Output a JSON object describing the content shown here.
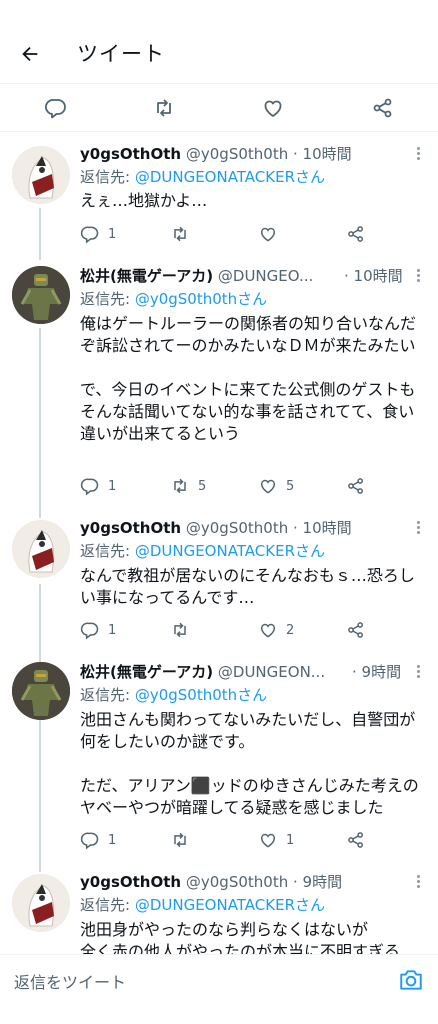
{
  "header": {
    "title": "ツイート"
  },
  "tweets": [
    {
      "name": "y0gsOthOth",
      "handle": "@y0gS0th0th",
      "time": "· 10時間",
      "reply_label": "返信先: ",
      "reply_to": "@DUNGEONATACKERさん",
      "text": "えぇ…地獄かよ…",
      "replies": "1",
      "retweets": "",
      "likes": ""
    },
    {
      "name": "松井(無電ゲーアカ)",
      "handle": "@DUNGEO...",
      "time": "· 10時間",
      "reply_label": "返信先: ",
      "reply_to": "@y0gS0th0thさん",
      "text": "俺はゲートルーラーの関係者の知り合いなんだぞ訴訟されてーのかみたいなＤＭが来たみたい\n\nで、今日のイベントに来てた公式側のゲストもそんな話聞いてない的な事を話されてて、食い違いが出来てるという",
      "replies": "1",
      "retweets": "5",
      "likes": "5"
    },
    {
      "name": "y0gsOthOth",
      "handle": "@y0gS0th0th",
      "time": "· 10時間",
      "reply_label": "返信先: ",
      "reply_to": "@DUNGEONATACKERさん",
      "text": "なんで教祖が居ないのにそんなおもｓ…恐ろしい事になってるんです…",
      "replies": "1",
      "retweets": "",
      "likes": "2"
    },
    {
      "name": "松井(無電ゲーアカ)",
      "handle": "@DUNGEON...",
      "time": "· 9時間",
      "reply_label": "返信先: ",
      "reply_to": "@y0gS0th0thさん",
      "text": "池田さんも関わってないみたいだし、自警団が何をしたいのか謎です。\n\nただ、アリアン⬛ッドのゆきさんじみた考えのヤベーやつが暗躍してる疑惑を感じました",
      "replies": "1",
      "retweets": "",
      "likes": "1"
    },
    {
      "name": "y0gsOthOth",
      "handle": "@y0gS0th0th",
      "time": "· 9時間",
      "reply_label": "返信先: ",
      "reply_to": "@DUNGEONATACKERさん",
      "text": "池田身がやったのなら判らなくはないが\n全く赤の他人がやったのが本当に不明すぎる",
      "replies": "",
      "retweets": "",
      "likes": ""
    }
  ],
  "reply_bar": {
    "placeholder": "返信をツイート"
  },
  "colors": {
    "accent": "#1d9bf0",
    "muted": "#536471",
    "text": "#0f1419"
  },
  "icons": [
    "back-arrow-icon",
    "reply-icon",
    "retweet-icon",
    "like-icon",
    "share-icon",
    "more-icon",
    "camera-icon"
  ]
}
